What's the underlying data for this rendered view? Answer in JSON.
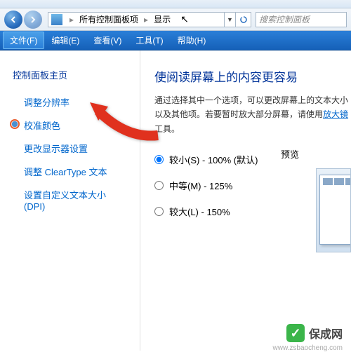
{
  "breadcrumb": {
    "item1": "所有控制面板项",
    "item2": "显示"
  },
  "search": {
    "placeholder": "搜索控制面板"
  },
  "menu": {
    "file": "文件(F)",
    "edit": "编辑(E)",
    "view": "查看(V)",
    "tools": "工具(T)",
    "help": "帮助(H)"
  },
  "sidebar": {
    "home": "控制面板主页",
    "resolution": "调整分辨率",
    "calibrate": "校准颜色",
    "monitor": "更改显示器设置",
    "cleartype": "调整 ClearType 文本",
    "dpi": "设置自定义文本大小(DPI)"
  },
  "main": {
    "title": "使阅读屏幕上的内容更容易",
    "desc1": "通过选择其中一个选项，可以更改屏幕上的文本大小以及其他项。若要暂时放大部分屏幕，请使用",
    "magnifier": "放大镜",
    "desc2": "工具。",
    "opt_small": "较小(S) - 100% (默认)",
    "opt_medium": "中等(M) - 125%",
    "opt_large": "较大(L) - 150%",
    "preview": "预览"
  },
  "watermark": {
    "text": "保成网",
    "url": "www.zsbaocheng.com"
  }
}
